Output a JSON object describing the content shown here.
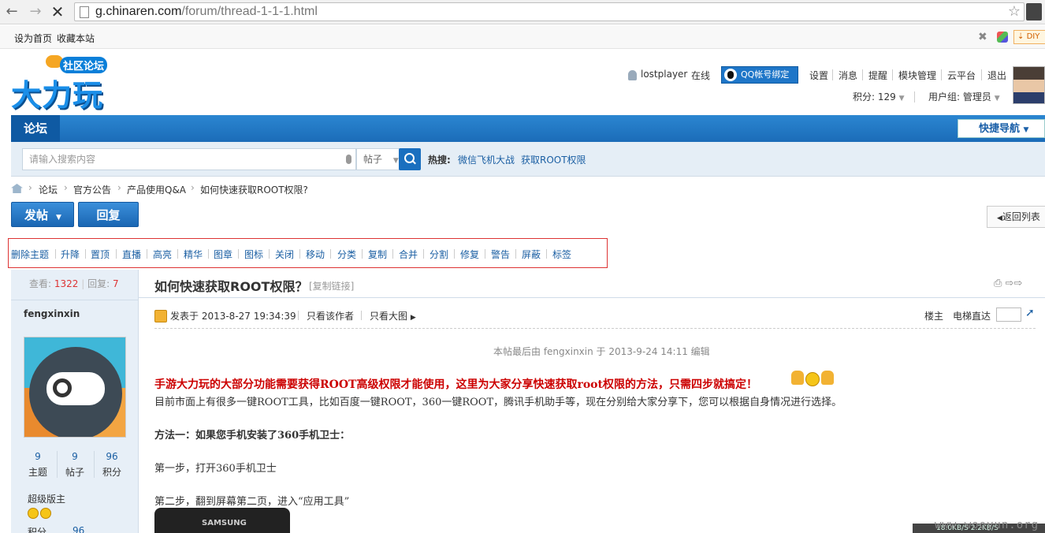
{
  "browser": {
    "url_host": "g.chinaren.com",
    "url_path": "/forum/thread-1-1-1.html"
  },
  "bookmarks": {
    "set_home": "设为首页",
    "add_fav": "收藏本站",
    "diy": "DIY"
  },
  "logo": {
    "subtitle": "社区论坛",
    "main": "大力玩"
  },
  "user": {
    "name": "lostplayer",
    "status": "在线",
    "qq_bind": "QQ帐号绑定",
    "links": [
      "设置",
      "消息",
      "提醒",
      "模块管理",
      "云平台",
      "退出"
    ],
    "score": "积分: 129",
    "group": "用户组: 管理员"
  },
  "nav": {
    "forum": "论坛",
    "quick_nav": "快捷导航"
  },
  "search": {
    "placeholder": "请输入搜索内容",
    "type": "帖子",
    "hot_label": "热搜:",
    "hot_links": [
      "微信飞机大战",
      "获取ROOT权限"
    ]
  },
  "breadcrumb": [
    "论坛",
    "官方公告",
    "产品使用Q&A",
    "如何快速获取ROOT权限?"
  ],
  "buttons": {
    "post": "发帖",
    "reply": "回复",
    "back_list": "返回列表"
  },
  "admin_actions": [
    "删除主题",
    "升降",
    "置顶",
    "直播",
    "高亮",
    "精华",
    "图章",
    "图标",
    "关闭",
    "移动",
    "分类",
    "复制",
    "合并",
    "分割",
    "修复",
    "警告",
    "屏蔽",
    "标签"
  ],
  "thread": {
    "views_label": "查看:",
    "views": "1322",
    "replies_label": "回复:",
    "replies": "7",
    "title": "如何快速获取ROOT权限？",
    "copy_link": "[复制链接]"
  },
  "author": {
    "name": "fengxinxin",
    "stats": [
      {
        "num": "9",
        "label": "主题"
      },
      {
        "num": "9",
        "label": "帖子"
      },
      {
        "num": "96",
        "label": "积分"
      }
    ],
    "rank": "超级版主",
    "points_label": "积分",
    "points": "96"
  },
  "post": {
    "posted_at": "发表于 2013-8-27 19:34:39",
    "only_author": "只看该作者",
    "only_big_img": "只看大图",
    "floor": "楼主",
    "elevator": "电梯直达",
    "edit_note": "本帖最后由 fengxinxin 于 2013-9-24 14:11 编辑",
    "intro": "手游大力玩的大部分功能需要获得ROOT高级权限才能使用，这里为大家分享快速获取root权限的方法，只需四步就搞定！",
    "line1": "目前市面上有很多一键ROOT工具，比如百度一键ROOT，360一键ROOT，腾讯手机助手等，现在分别给大家分享下，您可以根据自身情况进行选择。",
    "method1_label": "方法一：",
    "method1": "如果您手机安装了360手机卫士：",
    "step1": "第一步，打开360手机卫士",
    "step2": "第二步，翻到屏幕第二页，进入“应用工具”",
    "phone_brand": "SAMSUNG"
  },
  "footer": {
    "watermark": "www.wooyun.org",
    "speed": "18.0KB/S  2.2KB/S"
  }
}
